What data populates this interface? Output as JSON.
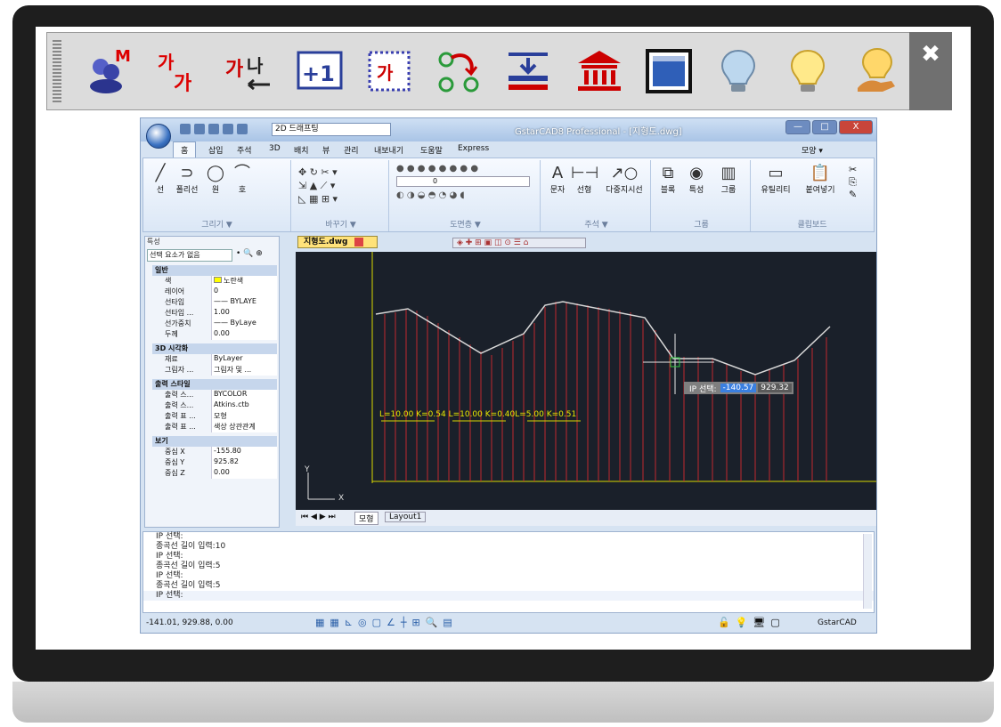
{
  "bigbar": {
    "buttons": [
      {
        "name": "toolbar-button-1",
        "icon": "users-m-icon"
      },
      {
        "name": "toolbar-button-2",
        "icon": "text-size-icon"
      },
      {
        "name": "toolbar-button-3",
        "icon": "text-swap-icon"
      },
      {
        "name": "toolbar-button-4",
        "icon": "increment-icon"
      },
      {
        "name": "toolbar-button-5",
        "icon": "text-frame-icon"
      },
      {
        "name": "toolbar-button-6",
        "icon": "node-link-icon"
      },
      {
        "name": "toolbar-button-7",
        "icon": "insert-line-icon"
      },
      {
        "name": "toolbar-button-8",
        "icon": "bank-icon"
      },
      {
        "name": "toolbar-button-9",
        "icon": "window-icon"
      },
      {
        "name": "toolbar-button-10",
        "icon": "bulb-off-icon"
      },
      {
        "name": "toolbar-button-11",
        "icon": "bulb-on-icon"
      },
      {
        "name": "toolbar-button-12",
        "icon": "bulb-hand-icon"
      }
    ],
    "close_label": "✖"
  },
  "window": {
    "workspace": "2D 드래프팅",
    "title": "GstarCAD8 Professional - [지형도.dwg]",
    "tabs": [
      "홈",
      "삽입",
      "주석",
      "3D",
      "배치",
      "뷰",
      "관리",
      "내보내기",
      "도움말",
      "Express"
    ],
    "style_label": "모양 ▾"
  },
  "ribbon": {
    "groups": [
      {
        "label": "그리기 ▼",
        "tools": [
          "선",
          "폴리선",
          "원",
          "호"
        ]
      },
      {
        "label": "바꾸기 ▼",
        "tools": []
      },
      {
        "label": "도면층 ▼",
        "tools": []
      },
      {
        "label": "주석 ▼",
        "tools": [
          "문자",
          "선형",
          "다중지시선"
        ]
      },
      {
        "label": "그룹",
        "tools": [
          "블록",
          "특성",
          "그룹"
        ]
      },
      {
        "label": "클립보드",
        "tools": [
          "유틸리티",
          "붙여넣기"
        ]
      }
    ],
    "layer_value": "0"
  },
  "props": {
    "header": "특성",
    "selection": "선택 요소가 없음",
    "sections": [
      {
        "title": "일반",
        "rows": [
          [
            "색",
            "노란색"
          ],
          [
            "레이어",
            "0"
          ],
          [
            "선타입",
            "—— BYLAYE"
          ],
          [
            "선타입 ...",
            "1.00"
          ],
          [
            "선가중치",
            "—— ByLaye"
          ],
          [
            "두께",
            "0.00"
          ]
        ]
      },
      {
        "title": "3D 시각화",
        "rows": [
          [
            "재료",
            "ByLayer"
          ],
          [
            "그림자 ...",
            "그림자 및 ..."
          ]
        ]
      },
      {
        "title": "출력 스타일",
        "rows": [
          [
            "출력 스...",
            "BYCOLOR"
          ],
          [
            "출력 스...",
            "Atkins.ctb"
          ],
          [
            "출력 표 ...",
            "모형"
          ],
          [
            "출력 표 ...",
            "색상 상관관계"
          ]
        ]
      },
      {
        "title": "보기",
        "rows": [
          [
            "중심 X",
            "-155.80"
          ],
          [
            "중심 Y",
            "925.82"
          ],
          [
            "중심 Z",
            "0.00"
          ]
        ]
      }
    ]
  },
  "doc": {
    "tab": "지형도.dwg",
    "annotations": [
      "L=10.00",
      "K=0.54",
      "L=10.00",
      "K=0.40",
      "L=5.00",
      "K=0.51"
    ],
    "ip_prompt": "IP 선택:",
    "ip_x": "-140.57",
    "ip_y": "929.32",
    "axis_y": "Y",
    "axis_x": "X"
  },
  "layout_tabs": [
    "모형",
    "Layout1"
  ],
  "command": {
    "lines": [
      "IP 선택:",
      "종곡선 길이 입력:10",
      "IP 선택:",
      "종곡선 길이 입력:5",
      "IP 선택:",
      "종곡선 길이 입력:5",
      "IP 선택:"
    ]
  },
  "status": {
    "coords": "-141.01, 929.88, 0.00",
    "brand": "GstarCAD"
  }
}
